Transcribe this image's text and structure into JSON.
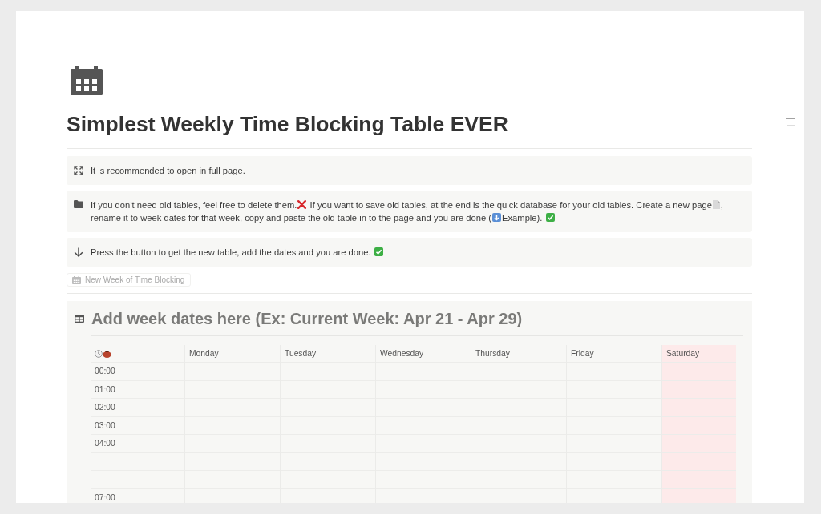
{
  "page": {
    "title": "Simplest Weekly Time Blocking Table EVER",
    "callouts": [
      {
        "kind": "expand",
        "segments": [
          {
            "kind": "text",
            "text": "It is recommended to open in full page."
          }
        ]
      },
      {
        "kind": "folder",
        "segments": [
          {
            "kind": "text",
            "text": "If you don’t need old tables, feel free to delete them."
          },
          {
            "kind": "cross"
          },
          {
            "kind": "text",
            "text": " If you want to save old tables, at the end is the quick database for your old tables. Create a new page"
          },
          {
            "kind": "document"
          },
          {
            "kind": "text",
            "text": ", "
          },
          {
            "kind": "text",
            "text": "rename it to week dates for that week, copy and paste the old table in to the page and you are done ("
          },
          {
            "kind": "down-square"
          },
          {
            "kind": "text",
            "text": "Example). "
          },
          {
            "kind": "check"
          }
        ]
      },
      {
        "kind": "arrow-down",
        "segments": [
          {
            "kind": "text",
            "text": "Press the button to get the new table, add the dates and you are done. "
          },
          {
            "kind": "check"
          }
        ]
      }
    ],
    "button": {
      "label": "New Week of Time Blocking"
    },
    "database": {
      "title": "Add week dates here (Ex: Current Week: Apr 21 - Apr 29)",
      "columns": [
        {
          "kind": "time"
        },
        {
          "kind": "day",
          "label": "Monday"
        },
        {
          "kind": "day",
          "label": "Tuesday"
        },
        {
          "kind": "day",
          "label": "Wednesday"
        },
        {
          "kind": "day",
          "label": "Thursday"
        },
        {
          "kind": "day",
          "label": "Friday"
        },
        {
          "kind": "day",
          "label": "Saturday",
          "color": "#fdeaea"
        }
      ],
      "rows": [
        {
          "time": "00:00"
        },
        {
          "time": "01:00"
        },
        {
          "time": "02:00"
        },
        {
          "time": "03:00"
        },
        {
          "time": "04:00"
        },
        {},
        {},
        {
          "time": "07:00"
        }
      ]
    }
  }
}
